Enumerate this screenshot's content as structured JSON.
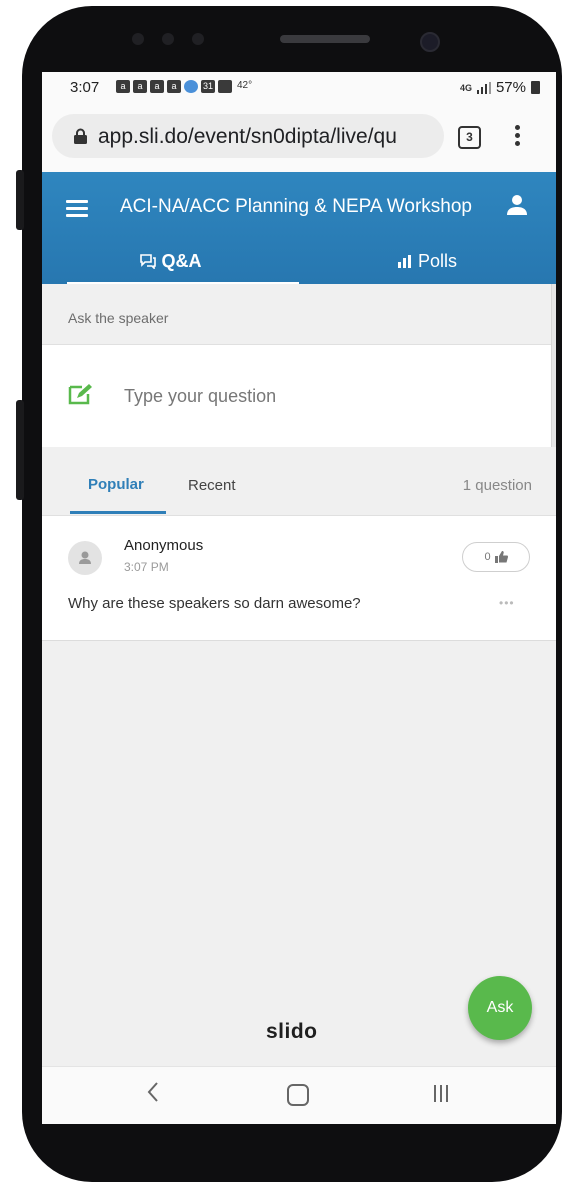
{
  "status_bar": {
    "time": "3:07",
    "temperature": "42°",
    "network": "4G",
    "battery": "57%",
    "notification_icons": [
      "aa-icon",
      "aa-icon",
      "aa-icon",
      "aa-icon",
      "app-blue-icon",
      "calendar-icon",
      "image-icon"
    ]
  },
  "browser": {
    "url": "app.sli.do/event/sn0dipta/live/qu",
    "tab_count": "3"
  },
  "app_bar": {
    "title": "ACI-NA/ACC Planning & NEPA Workshop",
    "tabs": [
      {
        "label": "Q&A",
        "icon": "speech-bubble-icon",
        "active": true
      },
      {
        "label": "Polls",
        "icon": "bar-chart-icon",
        "active": false
      }
    ]
  },
  "ask": {
    "header": "Ask the speaker",
    "placeholder": "Type your question"
  },
  "filters": {
    "popular": "Popular",
    "recent": "Recent",
    "count": "1 question"
  },
  "questions": [
    {
      "author": "Anonymous",
      "time": "3:07 PM",
      "likes": "0",
      "text": "Why are these speakers so darn awesome?"
    }
  ],
  "footer": {
    "logo": "slido",
    "ask_button": "Ask"
  },
  "colors": {
    "primary": "#2f86bf",
    "accent_green": "#59b94c",
    "background": "#f0f0f0"
  }
}
